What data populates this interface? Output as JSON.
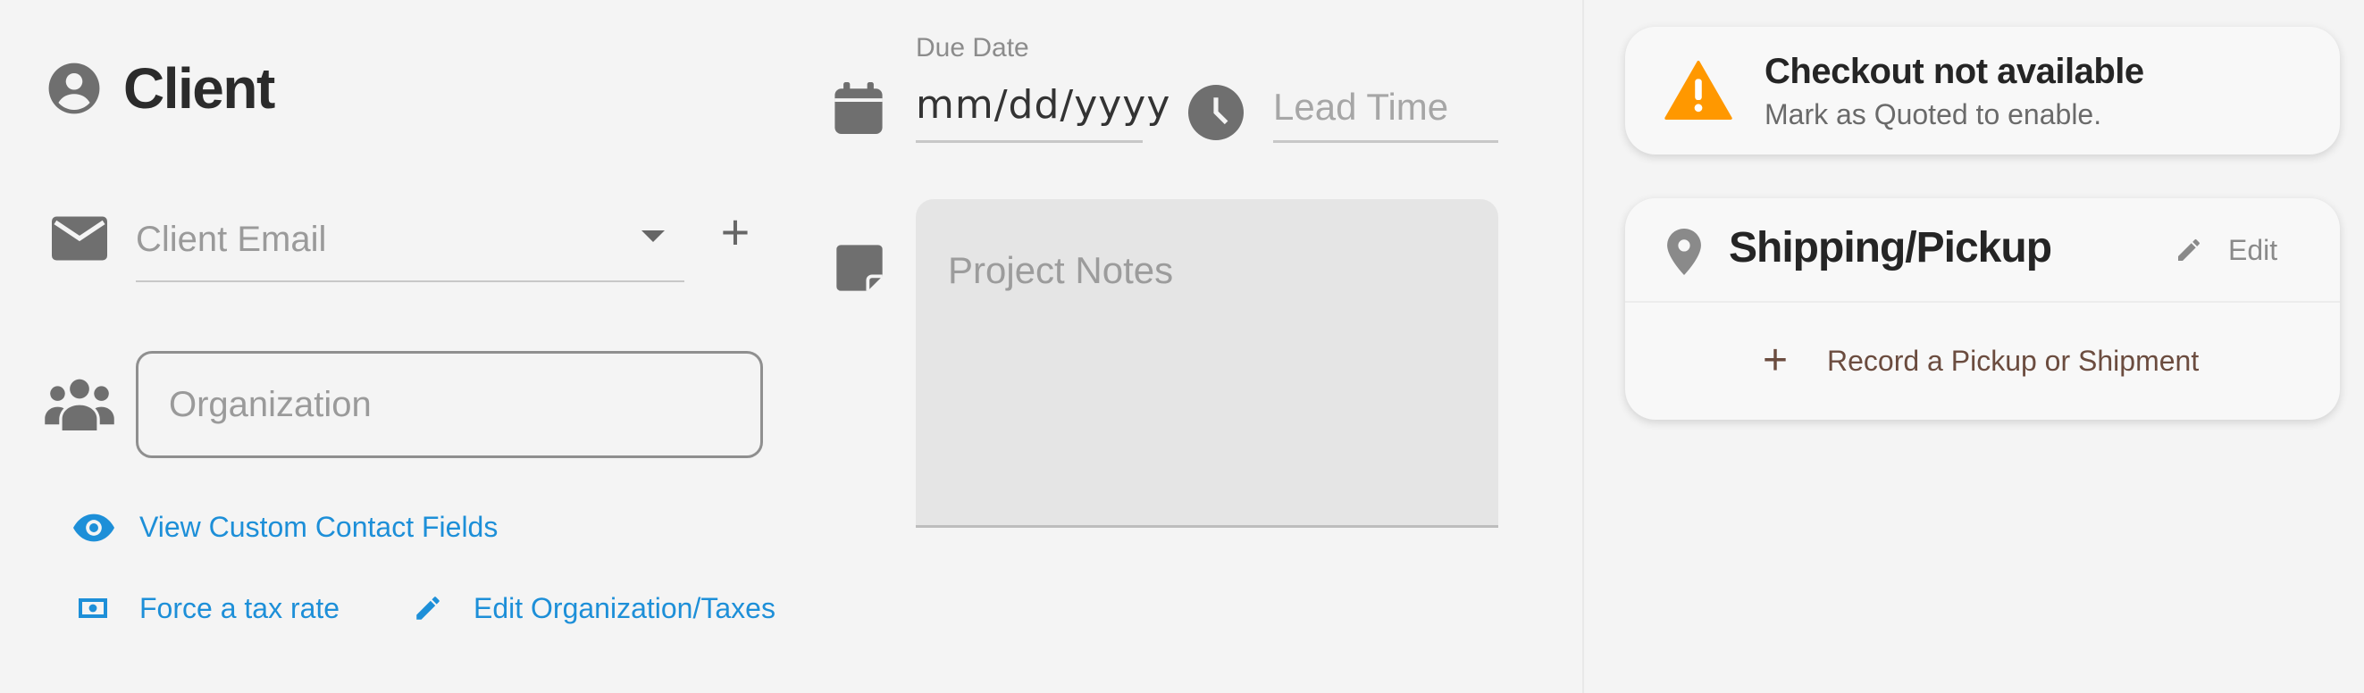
{
  "client": {
    "title": "Client",
    "email_placeholder": "Client Email",
    "add_label": "+",
    "organization_placeholder": "Organization",
    "view_custom_fields_label": "View Custom Contact Fields",
    "force_tax_label": "Force a tax rate",
    "edit_org_taxes_label": "Edit Organization/Taxes"
  },
  "dates": {
    "due_date_label": "Due Date",
    "due_date_value": "mm/dd/yyyy",
    "lead_time_placeholder": "Lead Time"
  },
  "notes": {
    "placeholder": "Project Notes"
  },
  "checkout_alert": {
    "title": "Checkout not available",
    "message": "Mark as Quoted to enable."
  },
  "shipping": {
    "title": "Shipping/Pickup",
    "edit_label": "Edit",
    "record_label": "Record a Pickup or Shipment"
  },
  "colors": {
    "link": "#1d8fd8",
    "warning": "#ff9800",
    "accent_brown": "#6b4c3f",
    "icon_gray": "#6f6f6f"
  },
  "icons": {
    "client": "account-circle-icon",
    "email": "envelope-icon",
    "organization": "group-icon",
    "view": "eye-icon",
    "tax": "money-icon",
    "edit": "pencil-icon",
    "calendar": "calendar-icon",
    "clock": "clock-icon",
    "notes": "sticky-note-icon",
    "warning": "warning-icon",
    "location": "location-pin-icon"
  }
}
